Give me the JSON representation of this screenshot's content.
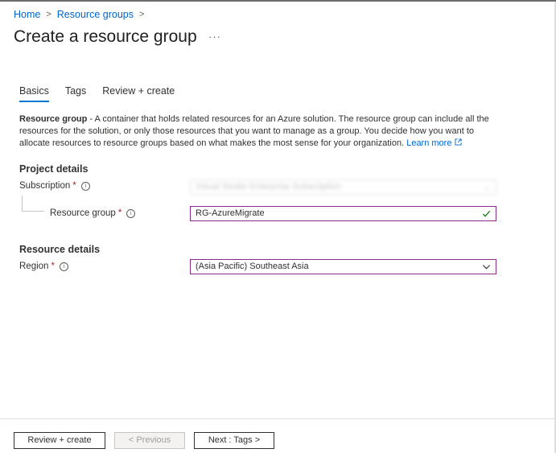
{
  "breadcrumb": {
    "home": "Home",
    "resource_groups": "Resource groups"
  },
  "page": {
    "title": "Create a resource group",
    "more": "···"
  },
  "tabs": [
    {
      "label": "Basics",
      "active": true
    },
    {
      "label": "Tags",
      "active": false
    },
    {
      "label": "Review + create",
      "active": false
    }
  ],
  "description": {
    "term": "Resource group",
    "text": " - A container that holds related resources for an Azure solution. The resource group can include all the resources for the solution, or only those resources that you want to manage as a group. You decide how you want to allocate resources to resource groups based on what makes the most sense for your organization. ",
    "learn_more": "Learn more"
  },
  "project_details": {
    "heading": "Project details",
    "subscription_label": "Subscription",
    "subscription_value": "Visual Studio Enterprise Subscription",
    "resource_group_label": "Resource group",
    "resource_group_value": "RG-AzureMigrate"
  },
  "resource_details": {
    "heading": "Resource details",
    "region_label": "Region",
    "region_value": "(Asia Pacific) Southeast Asia"
  },
  "required_mark": "*",
  "info_glyph": "i",
  "footer": {
    "review_create": "Review + create",
    "previous": "< Previous",
    "next": "Next : Tags >"
  },
  "colors": {
    "accent": "#0078d4",
    "link": "#0066cc",
    "required": "#a4262c",
    "valid": "#107c10",
    "field_border": "#8a2a8a"
  }
}
